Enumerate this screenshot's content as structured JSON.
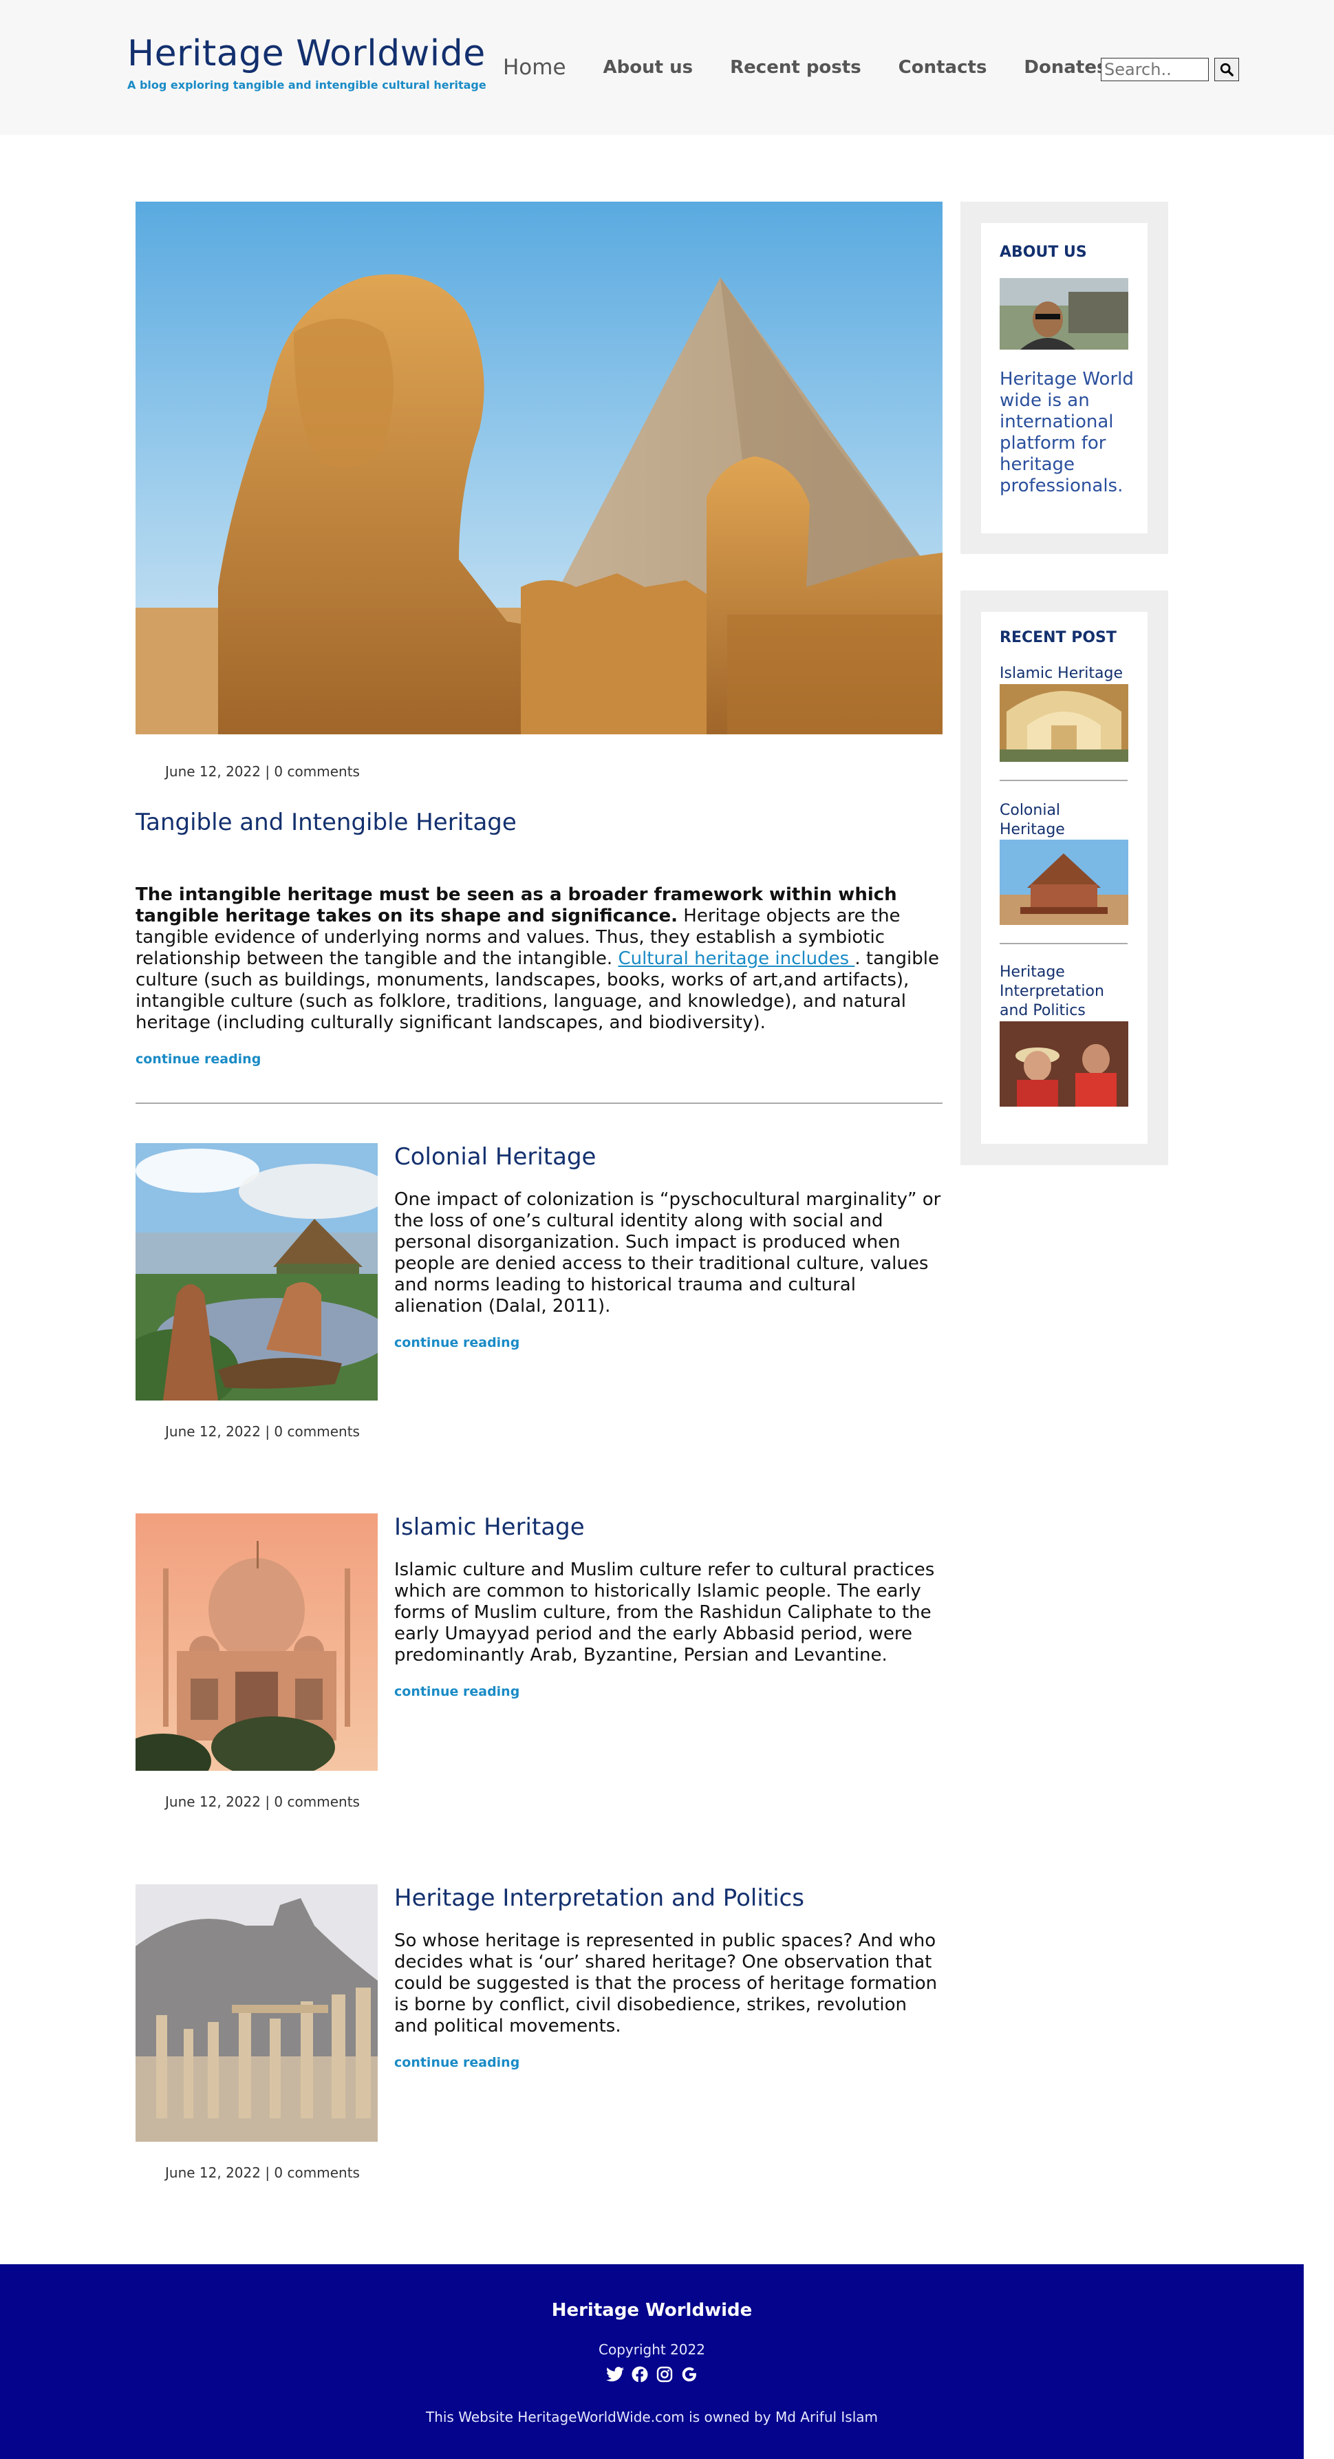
{
  "header": {
    "title": "Heritage Worldwide",
    "tagline": "A blog exploring tangible and intengible cultural heritage",
    "nav": [
      "Home",
      "About us",
      "Recent posts",
      "Contacts",
      "Donates"
    ],
    "search_placeholder": "Search.."
  },
  "featured": {
    "image": "sphinx-and-pyramid-photo",
    "meta": "June 12, 2022 | 0 comments",
    "title": "Tangible and Intengible Heritage",
    "lead_bold": "The intangible heritage must be seen as a broader framework within which tangible heritage takes on its shape and significance.",
    "text_1": " Heritage objects are the tangible evidence of underlying norms and values. Thus, they establish a symbiotic relationship between the tangible and the intangible. ",
    "link_text": "Cultural heritage includes ",
    "text_2": ". tangible culture (such as buildings, monuments, landscapes, books, works of art,and artifacts), intangible culture (such as folklore, traditions, language, and knowledge), and natural heritage (including culturally significant landscapes, and biodiversity).",
    "continue": "continue reading"
  },
  "posts": [
    {
      "title": "Colonial Heritage",
      "text": "One impact of colonization is “pyschocultural marginality” or the loss of one’s cultural identity along with social and personal disorganization. Such impact is produced when people are denied access to their traditional culture, values and norms leading to historical trauma and cultural alienation (Dalal, 2011).",
      "continue": "continue reading",
      "meta": "June 12, 2022 | 0 comments"
    },
    {
      "title": "Islamic Heritage",
      "text": "Islamic culture and Muslim culture refer to cultural practices which are common to historically Islamic people. The early forms of Muslim culture, from the Rashidun Caliphate to the early Umayyad period and the early Abbasid period, were predominantly Arab, Byzantine, Persian and Levantine.",
      "continue": "continue reading",
      "meta": "June 12, 2022 | 0 comments"
    },
    {
      "title": "Heritage Interpretation and Politics",
      "text": "So whose heritage is represented in public spaces? And who decides what is ‘our’ shared heritage? One observation that could be suggested is that the process of heritage formation is borne by conflict, civil disobedience, strikes, revolution and political movements.",
      "continue": "continue reading",
      "meta": "June 12, 2022 | 0 comments"
    }
  ],
  "sidebar": {
    "about_heading": "ABOUT US",
    "about_text": "Heritage World wide is an international platform for heritage professionals.",
    "recent_heading": "RECENT POST",
    "recent": [
      "Islamic Heritage",
      "Colonial Heritage",
      "Heritage Interpretation and Politics"
    ]
  },
  "footer": {
    "title": "Heritage Worldwide",
    "copyright": "Copyright 2022",
    "icons": [
      "twitter-icon",
      "facebook-icon",
      "instagram-icon",
      "google-icon"
    ],
    "owner": "This Website HeritageWorldWide.com is owned by Md Ariful Islam"
  },
  "colors": {
    "brand": "#13306e",
    "accent": "#1a8bc6",
    "footer_bg": "#04048c"
  }
}
